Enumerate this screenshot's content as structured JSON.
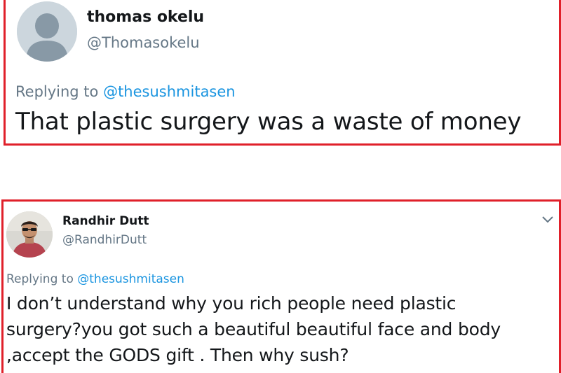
{
  "tweets": [
    {
      "name": "thomas okelu",
      "handle": "@Thomasokelu",
      "replying_prefix": "Replying to ",
      "replying_to": "@thesushmitasen",
      "text": "That plastic surgery was a waste of money"
    },
    {
      "name": "Randhir Dutt",
      "handle": "@RandhirDutt",
      "replying_prefix": "Replying to ",
      "replying_to": "@thesushmitasen",
      "text_lines": [
        "I don’t understand why you rich people need plastic",
        "surgery?you got such a beautiful beautiful face and body",
        ",accept the GODS gift . Then why sush?"
      ]
    }
  ],
  "colors": {
    "highlight_border": "#e0202a",
    "mention": "#1b95e0",
    "secondary_text": "#657786"
  },
  "icons": [
    "default-avatar-icon",
    "user-photo-avatar",
    "chevron-down-icon"
  ]
}
